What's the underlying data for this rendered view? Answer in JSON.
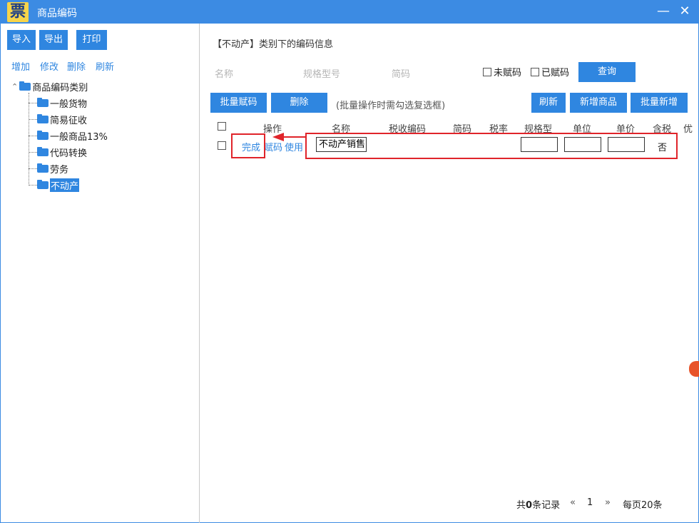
{
  "window": {
    "logo_text": "票",
    "title": "商品编码",
    "minimize": "—",
    "close": "✕"
  },
  "left": {
    "buttons": {
      "import": "导入",
      "export": "导出",
      "print": "打印"
    },
    "actions": {
      "add": "增加",
      "edit": "修改",
      "delete": "删除",
      "refresh": "刷新"
    },
    "tree": {
      "toggle": "⌃",
      "root": "商品编码类别",
      "items": [
        "一般货物",
        "简易征收",
        "一般商品13%",
        "代码转换",
        "劳务",
        "不动产"
      ],
      "selected_index": 5
    }
  },
  "main": {
    "header_info": "【不动产】类别下的编码信息",
    "filters": {
      "name_placeholder": "名称",
      "spec_placeholder": "规格型号",
      "short_code_placeholder": "简码",
      "unassigned": "未赋码",
      "assigned": "已赋码",
      "query_button": "查询"
    },
    "toolbar": {
      "batch_assign": "批量赋码",
      "delete": "删除",
      "hint": "(批量操作时需勾选复选框)",
      "refresh": "刷新",
      "add_product": "新增商品",
      "batch_add": "批量新增"
    },
    "table": {
      "columns": [
        "操作",
        "名称",
        "税收编码",
        "简码",
        "税率",
        "规格型",
        "单位",
        "单价",
        "含税",
        "优"
      ],
      "row": {
        "actions": {
          "done": "完成",
          "assign": "赋码",
          "use": "使用"
        },
        "name_value": "不动产销售",
        "tax_inclusive": "否"
      }
    },
    "pager": {
      "total_prefix": "共",
      "total_count": "0",
      "total_suffix": "条记录",
      "prev": "«",
      "page": "1",
      "next": "»",
      "per_page": "每页20条"
    }
  },
  "colors": {
    "accent": "#2f86e0",
    "titlebar": "#3c8be3",
    "highlight": "#e0242a"
  }
}
